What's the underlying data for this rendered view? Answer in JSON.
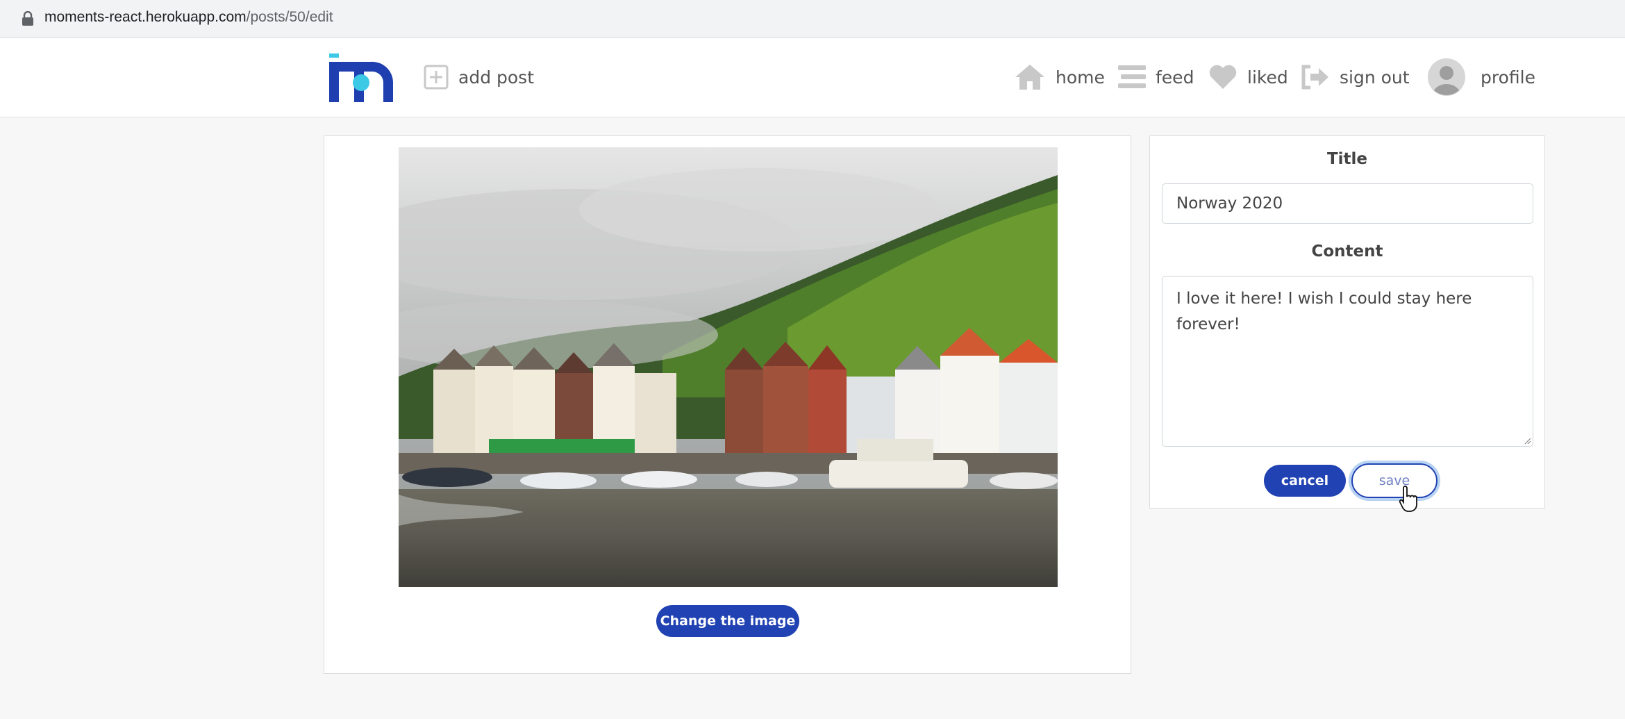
{
  "browser": {
    "url_host": "moments-react.herokuapp.com",
    "url_path": "/posts/50/edit"
  },
  "navbar": {
    "logo_icon": "moments-logo",
    "add_post": {
      "label": "add post",
      "icon": "plus-square-icon"
    },
    "items": [
      {
        "label": "home",
        "icon": "home-icon"
      },
      {
        "label": "feed",
        "icon": "stream-icon"
      },
      {
        "label": "liked",
        "icon": "heart-icon"
      },
      {
        "label": "sign out",
        "icon": "sign-out-icon"
      },
      {
        "label": "profile",
        "icon": "avatar"
      }
    ]
  },
  "image_panel": {
    "change_image_label": "Change the image"
  },
  "form": {
    "title_label": "Title",
    "title_value": "Norway 2020",
    "content_label": "Content",
    "content_value": "I love it here! I wish I could stay here forever!",
    "cancel_label": "cancel",
    "save_label": "save"
  },
  "colors": {
    "primary": "#2142b2",
    "logo_blue": "#1f3fb0",
    "logo_cyan": "#3cc9e6"
  }
}
